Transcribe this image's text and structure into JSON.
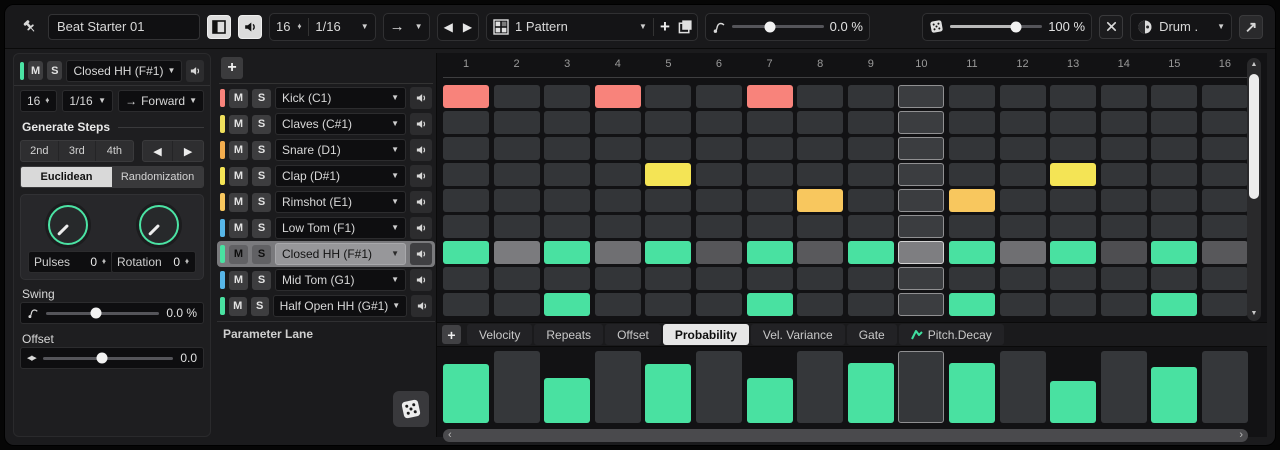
{
  "labels": {
    "mute": "M",
    "solo": "S",
    "plus": "+"
  },
  "icons": {
    "caret_down": "▼",
    "caret_up": "▲",
    "spin_up": "▲",
    "spin_down": "▼",
    "arrow_left": "◀",
    "arrow_right": "▶",
    "arrow_forward": "→",
    "expand": "↗",
    "scroll_up": "▲",
    "scroll_down": "▼",
    "scroll_left": "‹",
    "scroll_right": "›",
    "offset": "◀▶"
  },
  "colors": {
    "accent_green": "#49e1a1",
    "playhead_border": "#909092",
    "active_tab_bg": "#e6e6e6"
  },
  "toolbar": {
    "preset_name": "Beat Starter 01",
    "steps_value": "16",
    "resolution_value": "1/16",
    "pattern_label": "1 Pattern",
    "swing_value": "0.0 %",
    "random_amount": "100 %",
    "output_label": "Drum ."
  },
  "left_panel": {
    "selected_track": {
      "label": "Closed HH (F#1)",
      "color": "#4be3a4"
    },
    "steps_value": "16",
    "resolution_value": "1/16",
    "direction_label": "Forward",
    "generate_steps": {
      "title": "Generate Steps",
      "interval_buttons": [
        "2nd",
        "3rd",
        "4th"
      ],
      "tabs": [
        "Euclidean",
        "Randomization"
      ],
      "active_tab": "Euclidean",
      "knobs": [
        {
          "label": "Pulses",
          "value": "0"
        },
        {
          "label": "Rotation",
          "value": "0"
        }
      ]
    },
    "swing": {
      "label": "Swing",
      "value": "0.0 %"
    },
    "offset": {
      "label": "Offset",
      "value": "0.0"
    }
  },
  "tracks_panel": {
    "parameter_lane_label": "Parameter Lane"
  },
  "tracks": [
    {
      "name": "Kick (C1)",
      "color": "#f8837b",
      "steps": [
        1,
        4,
        7
      ],
      "selected": false,
      "hatched": false
    },
    {
      "name": "Claves (C#1)",
      "color": "#efdf5c",
      "steps": [],
      "selected": false,
      "hatched": false
    },
    {
      "name": "Snare (D1)",
      "color": "#f3ad4e",
      "steps": [],
      "selected": false,
      "hatched": false
    },
    {
      "name": "Clap (D#1)",
      "color": "#f4e455",
      "steps": [
        5,
        13
      ],
      "selected": false,
      "hatched": false
    },
    {
      "name": "Rimshot (E1)",
      "color": "#f8c75e",
      "steps": [
        8,
        11
      ],
      "selected": false,
      "hatched": false
    },
    {
      "name": "Low Tom (F1)",
      "color": "#57b6e8",
      "steps": [],
      "selected": false,
      "hatched": false
    },
    {
      "name": "Closed HH (F#1)",
      "color": "#49e1a1",
      "steps": [
        1,
        3,
        5,
        7,
        9,
        11,
        13,
        15
      ],
      "selected": true,
      "hatched": true,
      "inactive_shades": {
        "2": "#7b7b7e",
        "4": "#6f6f72",
        "6": "#565659",
        "8": "#59595c",
        "10": "#7e7e81",
        "12": "#6f6f72",
        "14": "#4e4e51",
        "16": "#58585b"
      }
    },
    {
      "name": "Mid Tom (G1)",
      "color": "#57b6e8",
      "steps": [],
      "selected": false,
      "hatched": false
    },
    {
      "name": "Half Open HH (G#1)",
      "color": "#49e1a1",
      "steps": [
        3,
        7,
        11,
        15
      ],
      "selected": false,
      "hatched": false
    }
  ],
  "grid": {
    "step_count": 16,
    "playhead_step": 10,
    "step_numbers": [
      "1",
      "2",
      "3",
      "4",
      "5",
      "6",
      "7",
      "8",
      "9",
      "10",
      "11",
      "12",
      "13",
      "14",
      "15",
      "16"
    ]
  },
  "parameter_lane": {
    "tabs": [
      {
        "label": "Velocity"
      },
      {
        "label": "Repeats"
      },
      {
        "label": "Offset"
      },
      {
        "label": "Probability"
      },
      {
        "label": "Vel. Variance"
      },
      {
        "label": "Gate"
      },
      {
        "label": "Pitch.Decay",
        "icon": "pitch-decay-icon"
      }
    ],
    "active_tab": "Probability",
    "values": {
      "1": 82,
      "3": 62,
      "5": 82,
      "7": 62,
      "9": 84,
      "11": 84,
      "13": 58,
      "15": 78
    }
  }
}
